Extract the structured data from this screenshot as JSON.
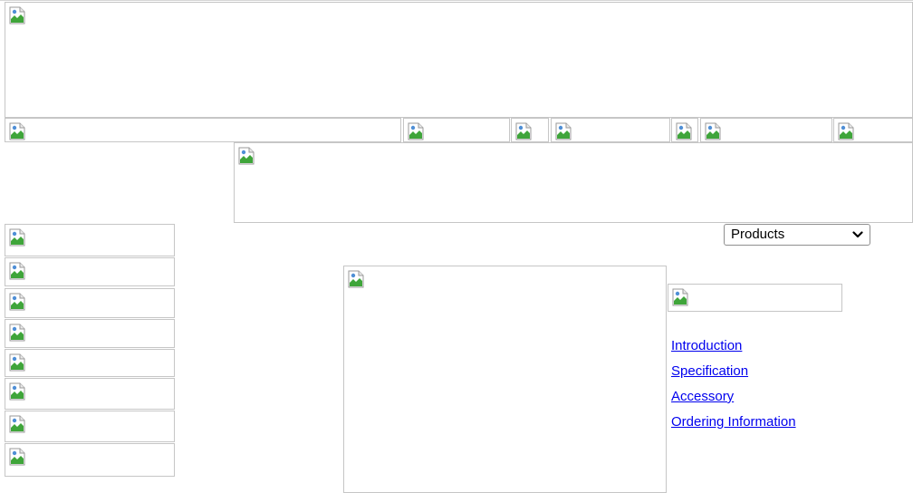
{
  "nav": {
    "products_select": {
      "selected": "Products"
    }
  },
  "product_links": [
    {
      "label": "Introduction"
    },
    {
      "label": "Specification"
    },
    {
      "label": "Accessory"
    },
    {
      "label": "Ordering Information"
    }
  ],
  "icons": {
    "broken_image": "broken-image-icon",
    "dropdown": "chevron-down-icon"
  },
  "colors": {
    "link": "#0000ee",
    "placeholder_border": "#c6c6c6"
  }
}
